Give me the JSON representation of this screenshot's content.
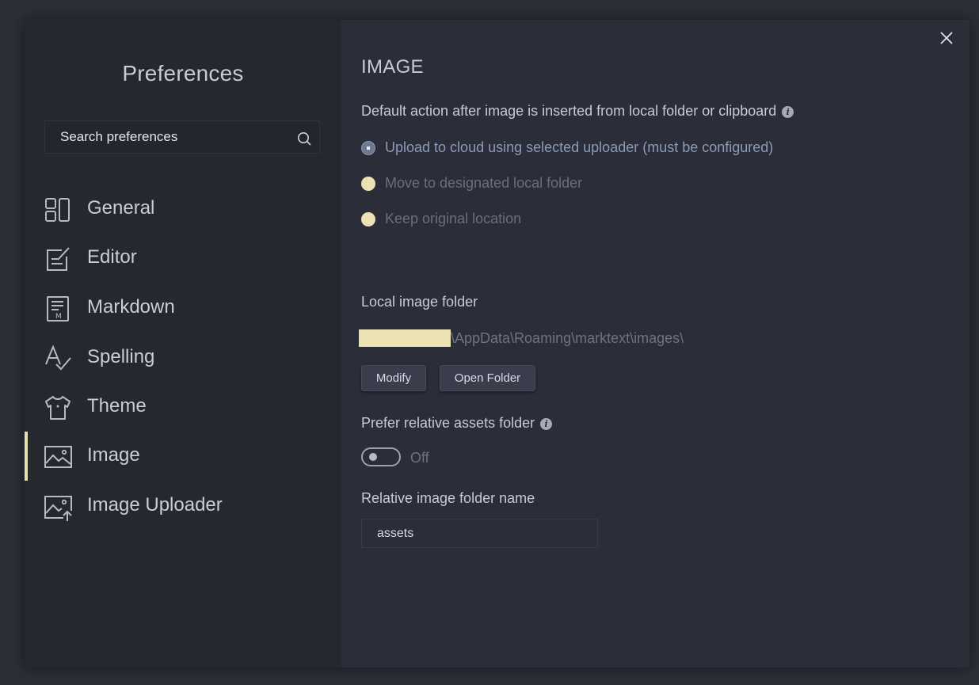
{
  "sidebar": {
    "title": "Preferences",
    "search": {
      "placeholder": "Search preferences",
      "icon": "search-icon"
    },
    "items": [
      {
        "label": "General",
        "icon": "general-layout-icon",
        "active": false
      },
      {
        "label": "Editor",
        "icon": "editor-pen-icon",
        "active": false
      },
      {
        "label": "Markdown",
        "icon": "markdown-doc-icon",
        "active": false
      },
      {
        "label": "Spelling",
        "icon": "spelling-check-icon",
        "active": false
      },
      {
        "label": "Theme",
        "icon": "theme-shirt-icon",
        "active": false
      },
      {
        "label": "Image",
        "icon": "image-icon",
        "active": true
      },
      {
        "label": "Image Uploader",
        "icon": "image-upload-icon",
        "active": false
      }
    ]
  },
  "main": {
    "section_title": "IMAGE",
    "default_action": {
      "label": "Default action after image is inserted from local folder or clipboard",
      "options": [
        {
          "label": "Upload to cloud using selected uploader (must be configured)",
          "checked": true
        },
        {
          "label": "Move to designated local folder",
          "checked": false
        },
        {
          "label": "Keep original location",
          "checked": false
        }
      ]
    },
    "local_folder": {
      "label": "Local image folder",
      "path_suffix": "\\AppData\\Roaming\\marktext\\images\\",
      "modify_label": "Modify",
      "open_label": "Open Folder"
    },
    "relative_assets": {
      "label": "Prefer relative assets folder",
      "enabled": false,
      "state_label": "Off"
    },
    "relative_folder_name": {
      "label": "Relative image folder name",
      "value": "assets"
    }
  },
  "colors": {
    "accent_highlight": "#ece2b4",
    "selected_radio": "#6e7893",
    "background": "#2b2d38",
    "sidebar_background": "#262830"
  }
}
